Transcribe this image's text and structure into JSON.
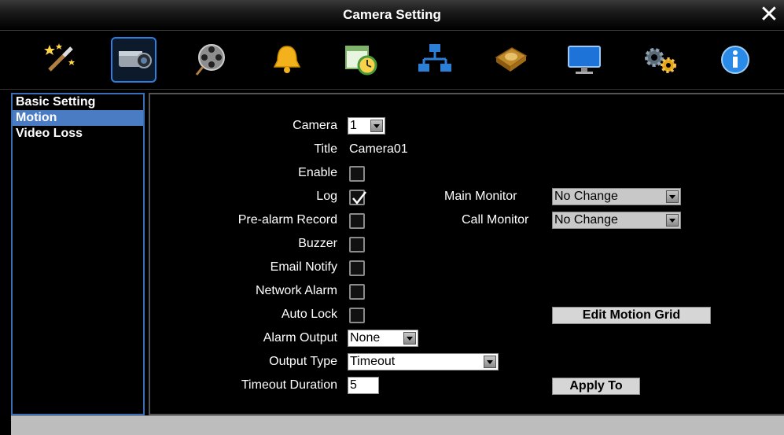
{
  "window": {
    "title": "Camera Setting"
  },
  "toolbar": {
    "icons": [
      "wizard-icon",
      "camera-icon",
      "film-reel-icon",
      "alarm-bell-icon",
      "schedule-clock-icon",
      "network-icon",
      "disk-icon",
      "monitor-icon",
      "gears-icon",
      "info-icon"
    ],
    "active": "camera-icon"
  },
  "sidebar": {
    "items": [
      {
        "label": "Basic Setting",
        "selected": false
      },
      {
        "label": "Motion",
        "selected": true
      },
      {
        "label": "Video Loss",
        "selected": false
      }
    ]
  },
  "form": {
    "camera": {
      "label": "Camera",
      "value": "1"
    },
    "title": {
      "label": "Title",
      "value": "Camera01"
    },
    "enable": {
      "label": "Enable",
      "checked": false
    },
    "log": {
      "label": "Log",
      "checked": true
    },
    "pre_alarm": {
      "label": "Pre-alarm Record",
      "checked": false
    },
    "buzzer": {
      "label": "Buzzer",
      "checked": false
    },
    "email": {
      "label": "Email Notify",
      "checked": false
    },
    "network_alarm": {
      "label": "Network Alarm",
      "checked": false
    },
    "auto_lock": {
      "label": "Auto Lock",
      "checked": false
    },
    "alarm_output": {
      "label": "Alarm Output",
      "value": "None"
    },
    "output_type": {
      "label": "Output Type",
      "value": "Timeout"
    },
    "timeout_duration": {
      "label": "Timeout Duration",
      "value": "5"
    },
    "main_monitor": {
      "label": "Main Monitor",
      "value": "No Change"
    },
    "call_monitor": {
      "label": "Call Monitor",
      "value": "No Change"
    },
    "edit_motion_grid": {
      "label": "Edit Motion Grid"
    },
    "apply": {
      "label": "Apply To"
    }
  },
  "colors": {
    "accent": "#4a7cc4",
    "border": "#3a6fb5",
    "background": "#000000"
  }
}
